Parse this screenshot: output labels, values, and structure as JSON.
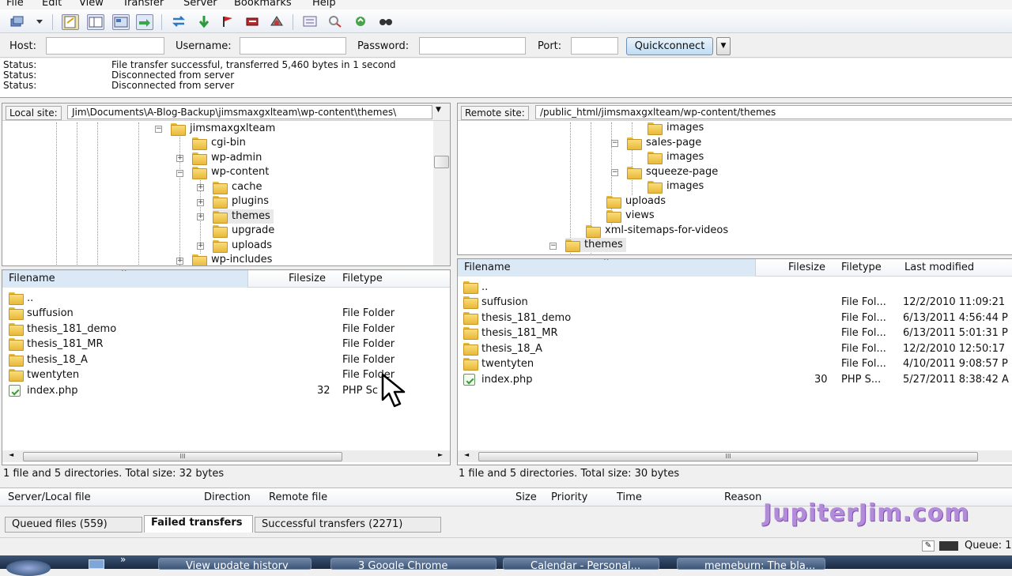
{
  "menu": [
    "File",
    "Edit",
    "View",
    "Transfer",
    "Server",
    "Bookmarks",
    "Help"
  ],
  "toolbar_icons": [
    "site-manager-icon",
    "dropdown-arrow-icon",
    "toggle-log-icon",
    "toggle-local-tree-icon",
    "toggle-remote-tree-icon",
    "toggle-queue-icon",
    "refresh-icon",
    "process-queue-icon",
    "cancel-icon",
    "disconnect-icon",
    "reconnect-icon",
    "filter-icon",
    "compare-icon",
    "sync-browse-icon",
    "search-icon"
  ],
  "quickconnect": {
    "host_label": "Host:",
    "username_label": "Username:",
    "password_label": "Password:",
    "port_label": "Port:",
    "host_value": "",
    "username_value": "",
    "password_value": "",
    "port_value": "",
    "button_label": "Quickconnect",
    "dropdown_glyph": "▼"
  },
  "log": [
    {
      "key": "Status:",
      "value": "File transfer successful, transferred 5,460 bytes in 1 second"
    },
    {
      "key": "Status:",
      "value": "Disconnected from server"
    },
    {
      "key": "Status:",
      "value": "Disconnected from server"
    }
  ],
  "local": {
    "site_label": "Local site:",
    "path": "Jim\\Documents\\A-Blog-Backup\\jimsmaxgxlteam\\wp-content\\themes\\",
    "tree": [
      {
        "label": "jimsmaxgxlteam",
        "toggle": "−"
      },
      {
        "label": "cgi-bin",
        "toggle": ""
      },
      {
        "label": "wp-admin",
        "toggle": "+"
      },
      {
        "label": "wp-content",
        "toggle": "−"
      },
      {
        "label": "cache",
        "toggle": "+"
      },
      {
        "label": "plugins",
        "toggle": "+"
      },
      {
        "label": "themes",
        "toggle": "+"
      },
      {
        "label": "upgrade",
        "toggle": ""
      },
      {
        "label": "uploads",
        "toggle": "+"
      },
      {
        "label": "wp-includes",
        "toggle": "+"
      }
    ],
    "columns": {
      "filename": "Filename",
      "filesize": "Filesize",
      "filetype": "Filetype"
    },
    "files": [
      {
        "name": "..",
        "size": "",
        "type": "",
        "icon": "folder"
      },
      {
        "name": "suffusion",
        "size": "",
        "type": "File Folder",
        "icon": "folder"
      },
      {
        "name": "thesis_181_demo",
        "size": "",
        "type": "File Folder",
        "icon": "folder"
      },
      {
        "name": "thesis_181_MR",
        "size": "",
        "type": "File Folder",
        "icon": "folder"
      },
      {
        "name": "thesis_18_A",
        "size": "",
        "type": "File Folder",
        "icon": "folder"
      },
      {
        "name": "twentyten",
        "size": "",
        "type": "File Folder",
        "icon": "folder"
      },
      {
        "name": "index.php",
        "size": "32",
        "type": "PHP Sc",
        "icon": "php"
      }
    ],
    "status": "1 file and 5 directories. Total size: 32 bytes"
  },
  "remote": {
    "site_label": "Remote site:",
    "path": "/public_html/jimsmaxgxlteam/wp-content/themes",
    "tree": [
      {
        "label": "images",
        "toggle": ""
      },
      {
        "label": "sales-page",
        "toggle": "−"
      },
      {
        "label": "images",
        "toggle": ""
      },
      {
        "label": "squeeze-page",
        "toggle": "−"
      },
      {
        "label": "images",
        "toggle": ""
      },
      {
        "label": "uploads",
        "toggle": ""
      },
      {
        "label": "views",
        "toggle": ""
      },
      {
        "label": "xml-sitemaps-for-videos",
        "toggle": ""
      },
      {
        "label": "themes",
        "toggle": "−"
      }
    ],
    "columns": {
      "filename": "Filename",
      "filesize": "Filesize",
      "filetype": "Filetype",
      "modified": "Last modified"
    },
    "files": [
      {
        "name": "..",
        "size": "",
        "type": "",
        "modified": "",
        "icon": "folder"
      },
      {
        "name": "suffusion",
        "size": "",
        "type": "File Fol...",
        "modified": "12/2/2010 11:09:21",
        "icon": "folder"
      },
      {
        "name": "thesis_181_demo",
        "size": "",
        "type": "File Fol...",
        "modified": "6/13/2011 4:56:44 P",
        "icon": "folder"
      },
      {
        "name": "thesis_181_MR",
        "size": "",
        "type": "File Fol...",
        "modified": "6/13/2011 5:01:31 P",
        "icon": "folder"
      },
      {
        "name": "thesis_18_A",
        "size": "",
        "type": "File Fol...",
        "modified": "12/2/2010 12:50:17",
        "icon": "folder"
      },
      {
        "name": "twentyten",
        "size": "",
        "type": "File Fol...",
        "modified": "4/10/2011 9:08:57 P",
        "icon": "folder"
      },
      {
        "name": "index.php",
        "size": "30",
        "type": "PHP S...",
        "modified": "5/27/2011 8:38:42 A",
        "icon": "php"
      }
    ],
    "status": "1 file and 5 directories. Total size: 30 bytes"
  },
  "queue": {
    "columns": [
      "Server/Local file",
      "Direction",
      "Remote file",
      "Size",
      "Priority",
      "Time",
      "Reason"
    ],
    "tabs": [
      "Queued files (559)",
      "Failed transfers",
      "Successful transfers (2271)"
    ],
    "active_tab": 1,
    "queue_label": "Queue: 1"
  },
  "watermark": "JupiterJim.com",
  "taskbar": [
    "View update history",
    "3 Google Chrome",
    "Calendar - Personal...",
    "memeburn: The bla..."
  ],
  "scroll_grip": "III",
  "colors": {
    "watermark": "#b38cd9",
    "header_active": "#dbe8f6",
    "taskbar": "#1a2a44"
  }
}
